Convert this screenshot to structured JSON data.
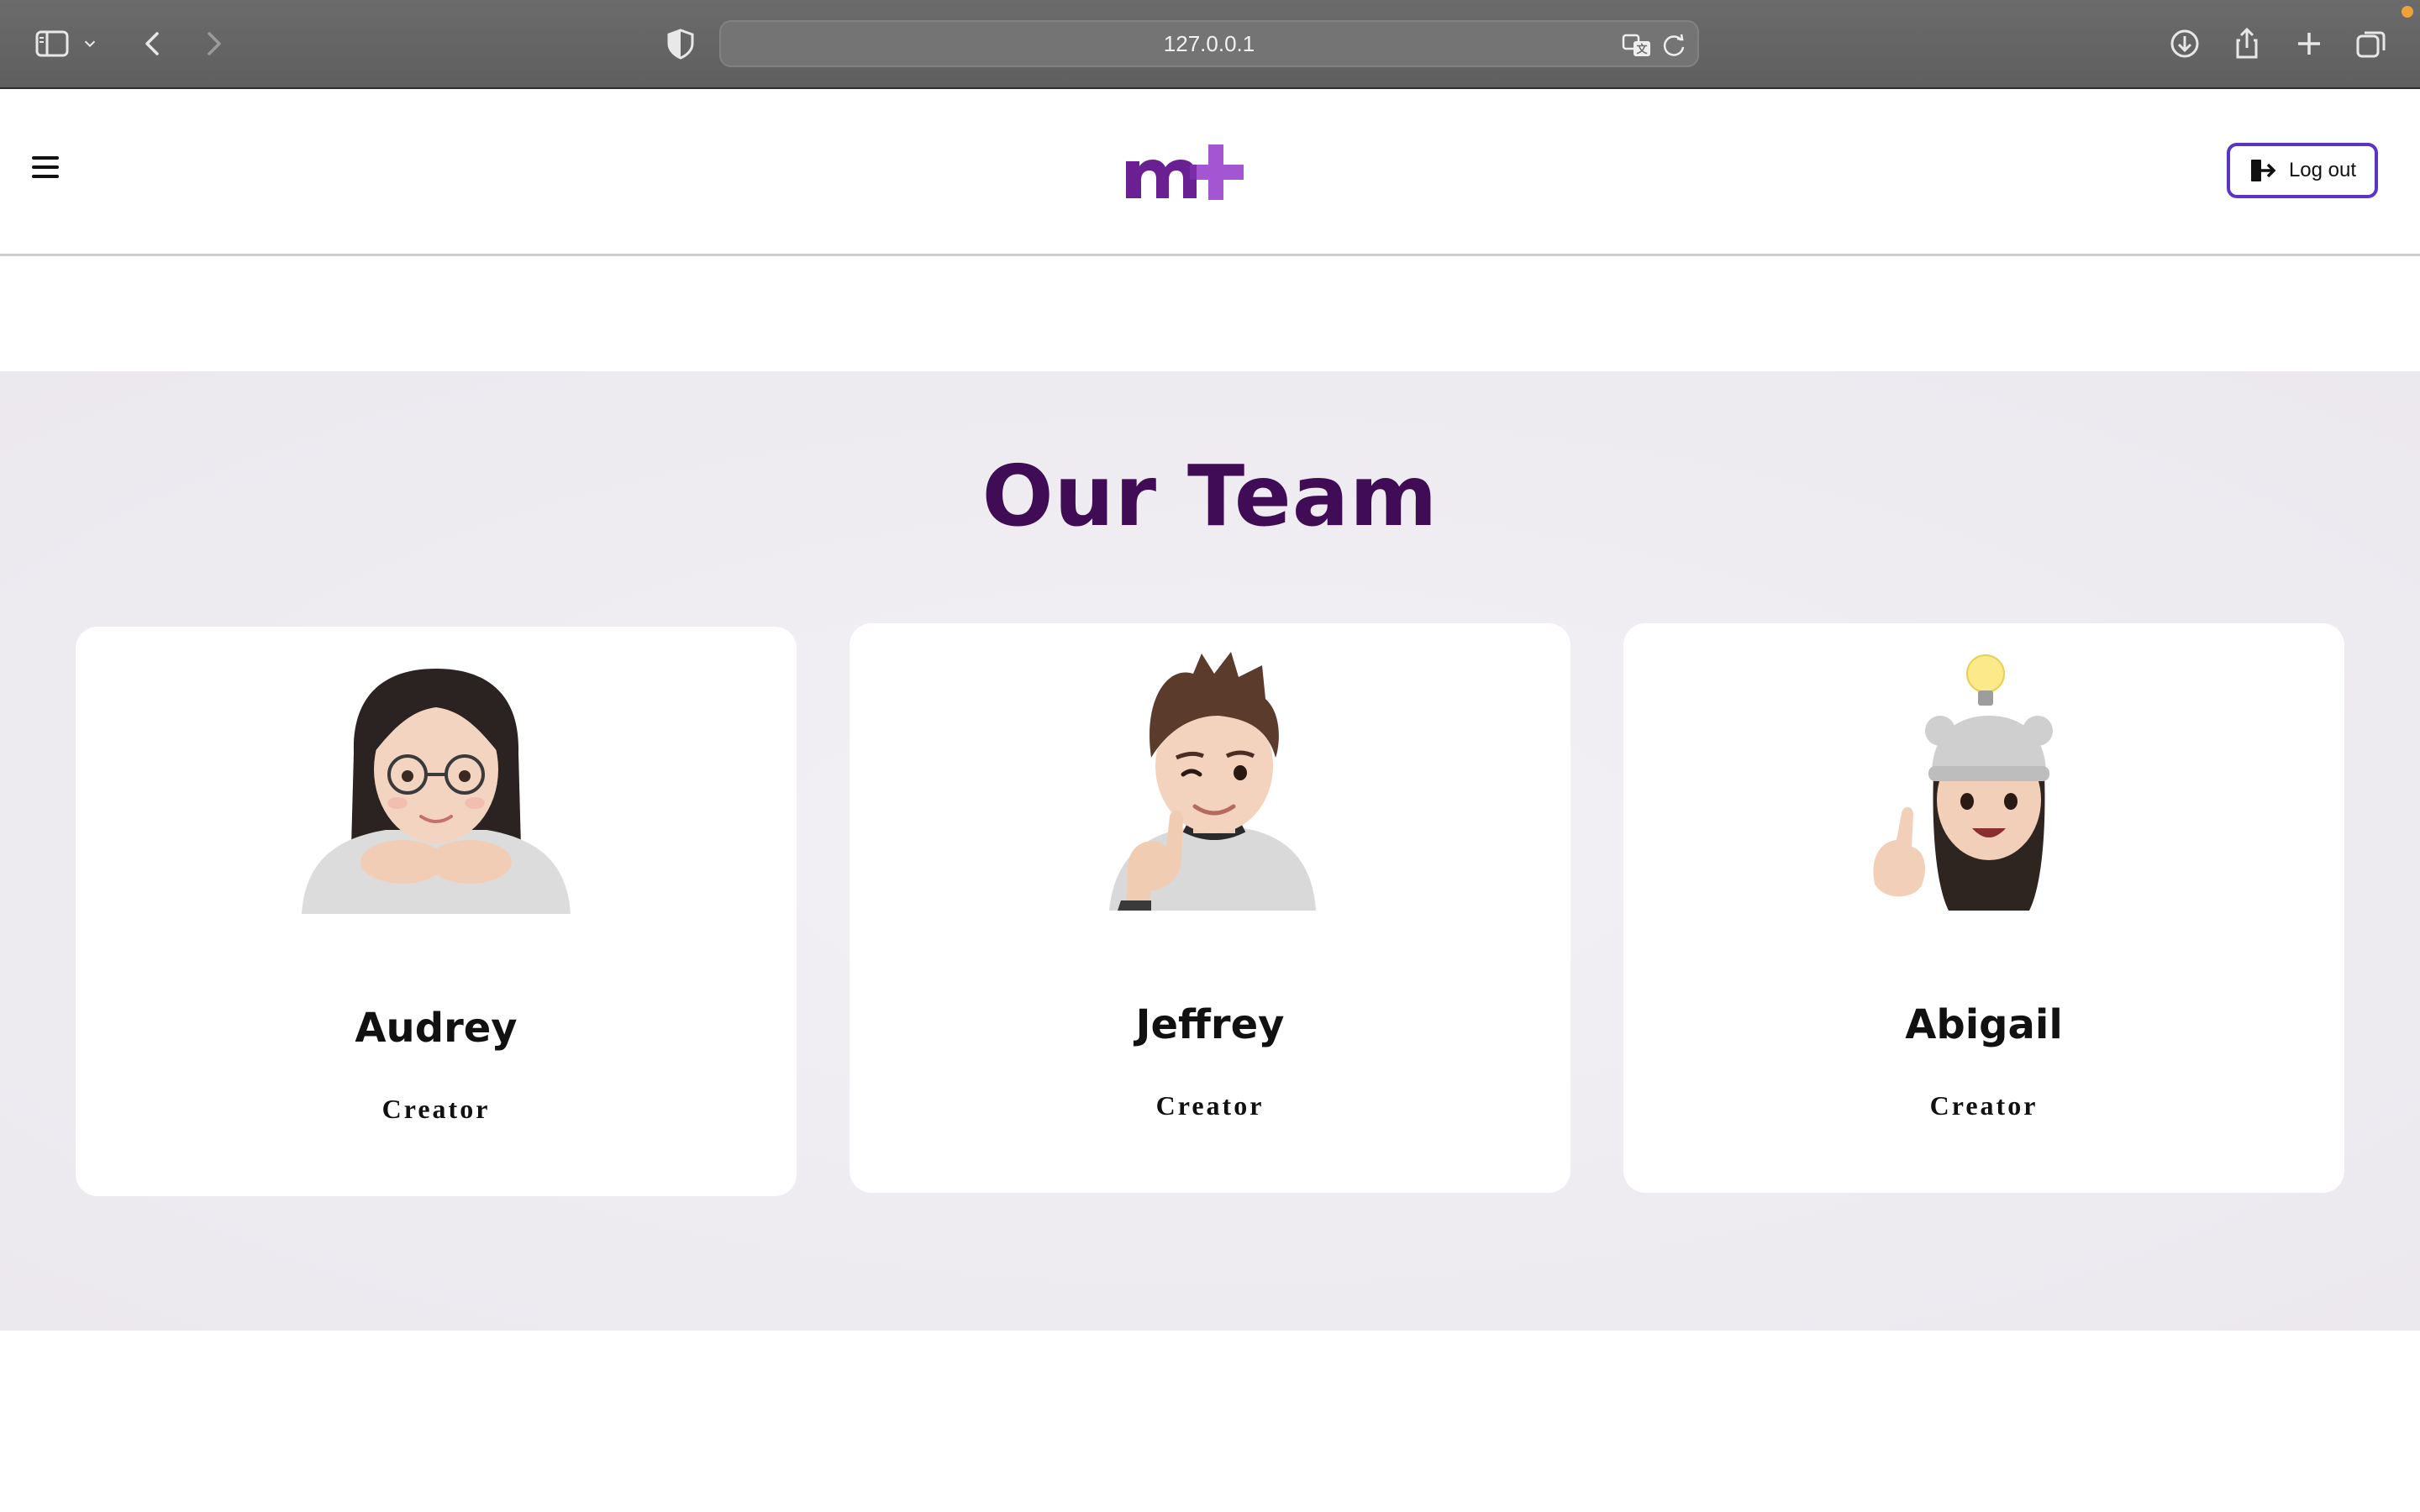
{
  "browser": {
    "url": "127.0.0.1",
    "icons": [
      "sidebar-icon",
      "chevron-down-icon",
      "back-icon",
      "forward-icon",
      "shield-icon",
      "translate-icon",
      "reload-icon",
      "download-icon",
      "share-icon",
      "new-tab-icon",
      "tab-overview-icon"
    ]
  },
  "header": {
    "logo_text": "m+",
    "logout_label": "Log out"
  },
  "team": {
    "title": "Our Team",
    "members": [
      {
        "name": "Audrey",
        "role": "Creator"
      },
      {
        "name": "Jeffrey",
        "role": "Creator"
      },
      {
        "name": "Abigail",
        "role": "Creator"
      }
    ]
  },
  "colors": {
    "brand_dark": "#3f0c55",
    "brand_light": "#a455d2",
    "button_border": "#5b33c7",
    "section_bg": "#ece9ef"
  }
}
